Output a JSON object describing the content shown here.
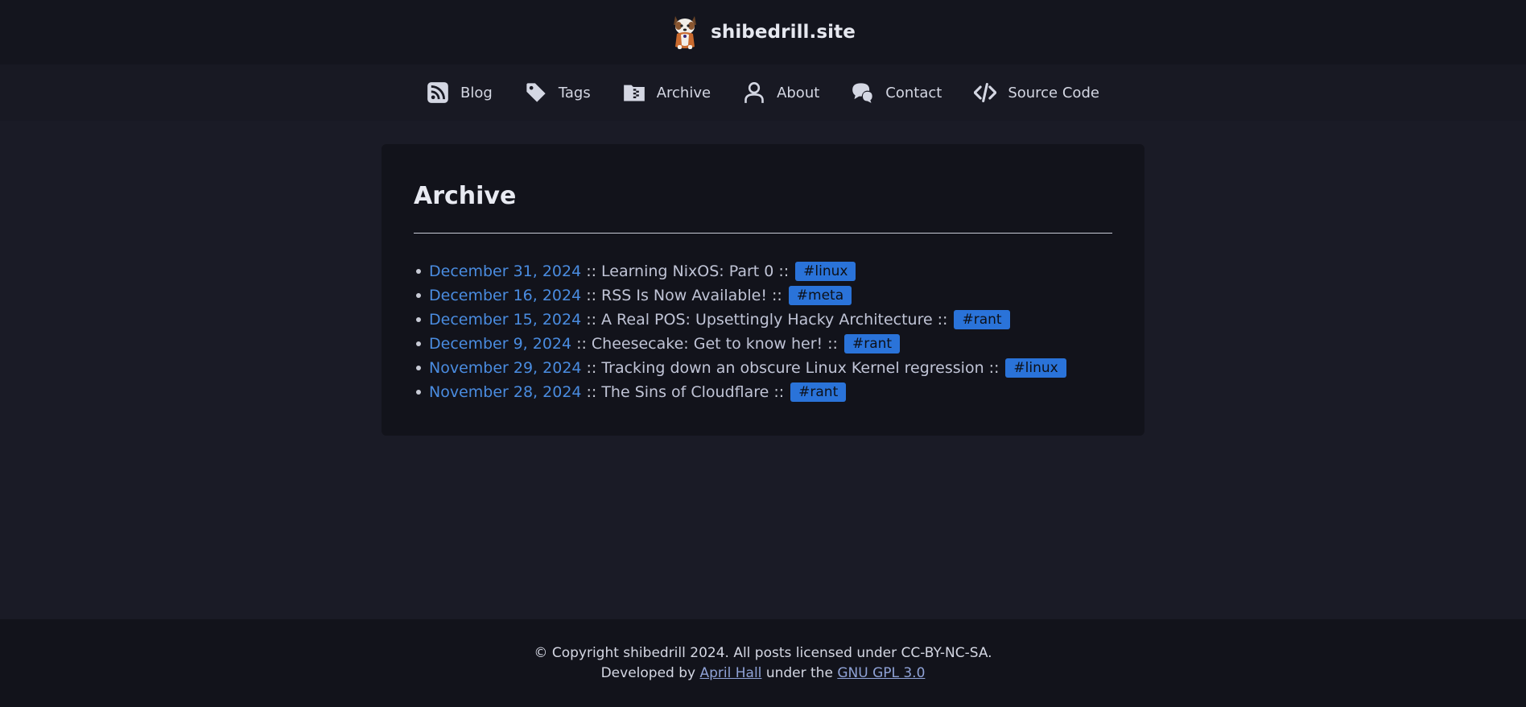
{
  "header": {
    "logo_icon": "shiba-dog-logo-icon",
    "title": "shibedrill.site"
  },
  "nav": {
    "items": [
      {
        "label": "Blog",
        "icon": "rss-icon"
      },
      {
        "label": "Tags",
        "icon": "tag-icon"
      },
      {
        "label": "Archive",
        "icon": "archive-folder-icon"
      },
      {
        "label": "About",
        "icon": "user-icon"
      },
      {
        "label": "Contact",
        "icon": "chat-bubbles-icon"
      },
      {
        "label": "Source Code",
        "icon": "code-brackets-icon"
      }
    ]
  },
  "main": {
    "title": "Archive",
    "separator": "::",
    "posts": [
      {
        "date": "December 31, 2024",
        "title": "Learning NixOS: Part 0",
        "tag": "#linux"
      },
      {
        "date": "December 16, 2024",
        "title": "RSS Is Now Available!",
        "tag": "#meta"
      },
      {
        "date": "December 15, 2024",
        "title": "A Real POS: Upsettingly Hacky Architecture",
        "tag": "#rant"
      },
      {
        "date": "December 9, 2024",
        "title": "Cheesecake: Get to know her!",
        "tag": "#rant"
      },
      {
        "date": "November 29, 2024",
        "title": "Tracking down an obscure Linux Kernel regression",
        "tag": "#linux"
      },
      {
        "date": "November 28, 2024",
        "title": "The Sins of Cloudflare",
        "tag": "#rant"
      }
    ]
  },
  "footer": {
    "copyright": "© Copyright shibedrill 2024. All posts licensed under CC-BY-NC-SA.",
    "dev_prefix": "Developed by ",
    "dev_name": "April Hall",
    "dev_middle": " under the ",
    "license": "GNU GPL 3.0"
  },
  "colors": {
    "background": "#1a1b26",
    "header_bg": "#14151e",
    "card_bg": "#12131b",
    "link_blue": "#4a8ce0",
    "tag_bg": "#2a73d9"
  }
}
